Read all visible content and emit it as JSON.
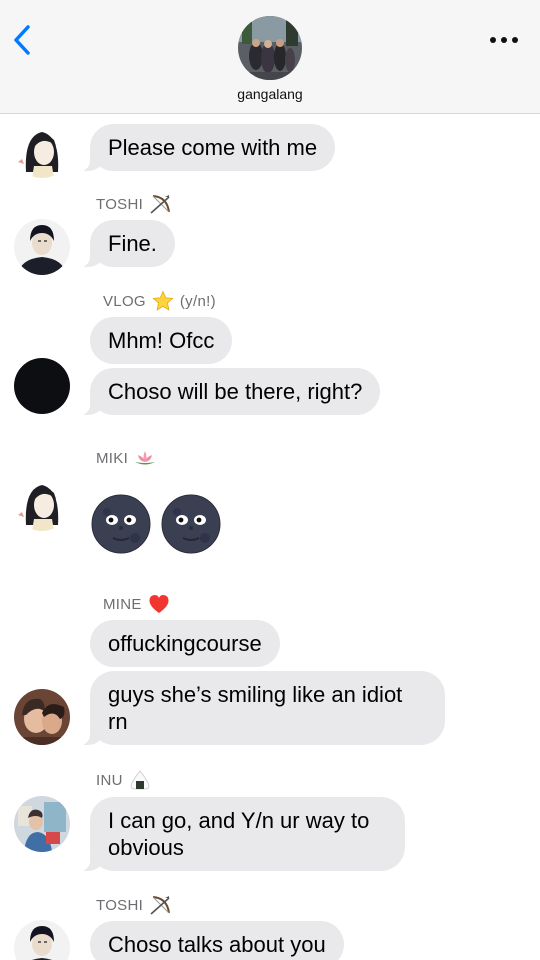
{
  "header": {
    "group_name": "gangalang"
  },
  "messages": [
    {
      "sender": "",
      "text": "Please come with me"
    },
    {
      "sender": "TOSHI",
      "sender_icon": "bow-and-arrow-icon",
      "text": "Fine."
    },
    {
      "sender": "VLOG",
      "sender_icon": "star-icon",
      "sender_note": "(y/n!)",
      "texts": [
        "Mhm! Ofcc",
        "Choso will be there, right?"
      ]
    },
    {
      "sender": "MIKI",
      "sender_icon": "lotus-icon",
      "emoji": [
        "new-moon-face-icon",
        "new-moon-face-icon"
      ]
    },
    {
      "sender": "MINE",
      "sender_icon": "red-heart-icon",
      "texts": [
        "offuckingcourse",
        "guys she’s smiling like an idiot",
        "rn"
      ]
    },
    {
      "sender": "INU",
      "sender_icon": "rice-ball-icon",
      "texts": [
        "I can go, and Y/n ur way to",
        "obvious"
      ]
    },
    {
      "sender": "TOSHI",
      "sender_icon": "bow-and-arrow-icon",
      "text": "Choso talks about you"
    }
  ],
  "colors": {
    "bubble": "#e9e9eb",
    "accent": "#007aff",
    "header_bg": "#f6f6f6",
    "sender_label": "#6d6d72"
  }
}
